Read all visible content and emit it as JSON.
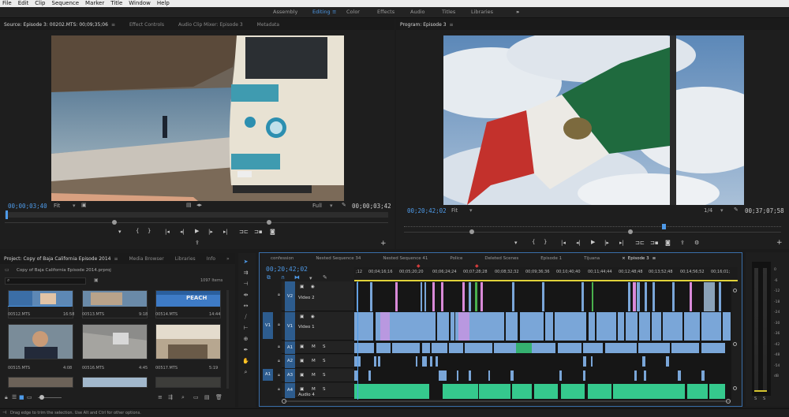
{
  "menu": [
    "File",
    "Edit",
    "Clip",
    "Sequence",
    "Marker",
    "Title",
    "Window",
    "Help"
  ],
  "workspaces": [
    "Assembly",
    "Editing",
    "Color",
    "Effects",
    "Audio",
    "Titles",
    "Libraries"
  ],
  "workspace_more": "»",
  "source": {
    "tabs": [
      "Source: Episode 3: 00202.MTS: 00;09;35;06",
      "Effect Controls",
      "Audio Clip Mixer: Episode 3",
      "Metadata"
    ],
    "tab_menu": "≡",
    "timecode_in": "00;00;03;40",
    "timecode_dur": "00;00;03;42",
    "fit": "Fit",
    "quality": "Full"
  },
  "program": {
    "tab": "Program: Episode 3",
    "tab_menu": "≡",
    "timecode_in": "00;20;42;02",
    "timecode_dur": "00;37;07;58",
    "fit": "Fit",
    "quality": "1/4"
  },
  "transport": {
    "marker": "▾",
    "in": "{",
    "out": "}",
    "go_in": "|◂",
    "step_back": "◂|",
    "play": "▶",
    "step_fwd": "|▸",
    "go_out": "▸|",
    "insert": "⊐⊏",
    "overwrite": "⊐▪",
    "export": "◙",
    "lift": "⇪",
    "add": "+"
  },
  "project": {
    "tabs": [
      "Project: Copy of Baja California Episode 2014",
      "Media Browser",
      "Libraries",
      "Info"
    ],
    "tab_menu": "≡",
    "more": "»",
    "path": "Copy of Baja California Episode 2014.prproj",
    "search_placeholder": "",
    "item_count": "1097 Items",
    "items": [
      {
        "name": "00512.MTS",
        "dur": "16:58"
      },
      {
        "name": "00513.MTS",
        "dur": "9:18"
      },
      {
        "name": "00514.MTS",
        "dur": "14:44"
      },
      {
        "name": "00515.MTS",
        "dur": "4:08"
      },
      {
        "name": "00516.MTS",
        "dur": "4:45"
      },
      {
        "name": "00517.MTS",
        "dur": "5:19"
      }
    ],
    "thumb_sign": "PEACH"
  },
  "timeline": {
    "tabs": [
      "confession",
      "Nested Sequence 34",
      "Nested Sequence 41",
      "Police",
      "Deleted Scenes",
      "Episode 1",
      "Tijuana",
      "Episode 3"
    ],
    "close_mark": "×",
    "tab_menu": "≡",
    "timecode": "00;20;42;02",
    "ruler": [
      ";12",
      "00;04;16;16",
      "00;05;20;20",
      "00;06;24;24",
      "00;07;28;28",
      "00;08;32;32",
      "00;09;36;36",
      "00;10;40;40",
      "00;11;44;44",
      "00;12;48;48",
      "00;13;52;48",
      "00;14;56;52",
      "00;16;01;"
    ],
    "tracks": [
      {
        "target": "",
        "name": "V2",
        "label": "Video 2"
      },
      {
        "target": "V1",
        "name": "V1",
        "label": "Video 1"
      },
      {
        "target": "",
        "name": "A1",
        "label": ""
      },
      {
        "target": "",
        "name": "A2",
        "label": ""
      },
      {
        "target": "A1",
        "name": "A3",
        "label": ""
      },
      {
        "target": "",
        "name": "A4",
        "label": "Audio 4"
      }
    ],
    "mute": "M",
    "solo": "S"
  },
  "meter": {
    "labels": [
      "0",
      "-6",
      "-12",
      "-18",
      "-24",
      "-30",
      "-36",
      "-42",
      "-48",
      "-54",
      "dB"
    ],
    "solo_left": "S",
    "solo_right": "S"
  },
  "status": {
    "text": "Drag edge to trim the selection. Use Alt and Ctrl for other options."
  },
  "colors": {
    "accent": "#4e9ae8",
    "video_clip": "#7aa6d8",
    "audio_clip": "#35c98d",
    "pink": "#d98ad8",
    "green": "#49b04c",
    "playhead": "#4e9ae8"
  }
}
